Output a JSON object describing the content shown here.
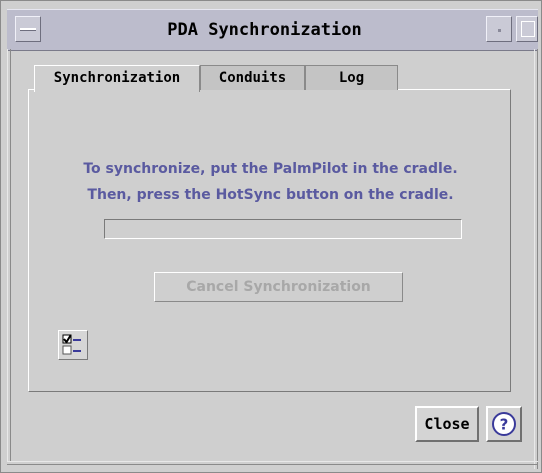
{
  "window": {
    "title": "PDA Synchronization"
  },
  "tabs": [
    {
      "label": "Synchronization",
      "active": true
    },
    {
      "label": "Conduits",
      "active": false
    },
    {
      "label": "Log",
      "active": false
    }
  ],
  "sync_panel": {
    "message_line1": "To synchronize, put the PalmPilot in the cradle.",
    "message_line2": "Then, press the HotSync button on the cradle.",
    "progress": 0,
    "cancel_label": "Cancel Synchronization",
    "cancel_enabled": false,
    "options_icon": "checklist-icon"
  },
  "footer": {
    "close_label": "Close",
    "help_icon": "help-icon"
  },
  "colors": {
    "message": "#5a5aa0",
    "disabled_text": "#a8a8a8",
    "titlebar": "#bcbccc"
  }
}
